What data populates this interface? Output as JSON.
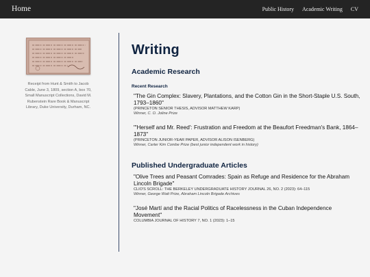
{
  "nav": {
    "home": "Home",
    "links": [
      "Public History",
      "Academic Writing",
      "CV"
    ]
  },
  "sidebar": {
    "caption": "Receipt from Hunt & Smith to Jacob Cable, June 3, 1809, section A, box 70, Small Manuscript Collections, David M. Rubenstein Rare Book & Manuscript Library, Duke University, Durham, NC."
  },
  "page": {
    "title": "Writing",
    "academic": {
      "heading": "Academic Research",
      "subheading": "Recent Research",
      "entries": [
        {
          "title": "\"The Gin Complex: Slavery, Plantations, and the Cotton Gin in the Short-Staple U.S. South, 1793–1860\"",
          "meta": "(PRINCETON SENIOR THESIS, ADVISOR MATTHEW KARP)",
          "award": "Winner, C. O. Joline Prize"
        },
        {
          "title": "\"'Herself and Mr. Reed': Frustration and Freedom at the Beaufort Freedman's Bank, 1864–1873\"",
          "meta": "(PRINCETON JUNIOR-YEAR PAPER, ADVISOR ALISON ISENBERG)",
          "award": "Winner, Carter Kim Combe Prize (best junior independent work in history)"
        }
      ]
    },
    "published": {
      "heading": "Published Undergraduate Articles",
      "entries": [
        {
          "title": "\"Olive Trees and Peasant Comrades: Spain as Refuge and Residence for the Abraham Lincoln Brigade\"",
          "meta": "CLIO'S SCROLL: THE BERKELEY UNDERGRADUATE HISTORY JOURNAL 26, NO. 2 (2023): 64–115",
          "award": "Winner, George Watt Prize, Abraham Lincoln Brigade Archives"
        },
        {
          "title": "\"José Martí and the Racial Politics of Racelessness in the Cuban Independence Movement\"",
          "meta": "COLUMBIA JOURNAL OF HISTORY 7, NO. 1 (2023): 1–15"
        }
      ]
    }
  },
  "colors": {
    "topbar": "#242424",
    "heading": "#0f2340",
    "background": "#f4f4f4"
  }
}
